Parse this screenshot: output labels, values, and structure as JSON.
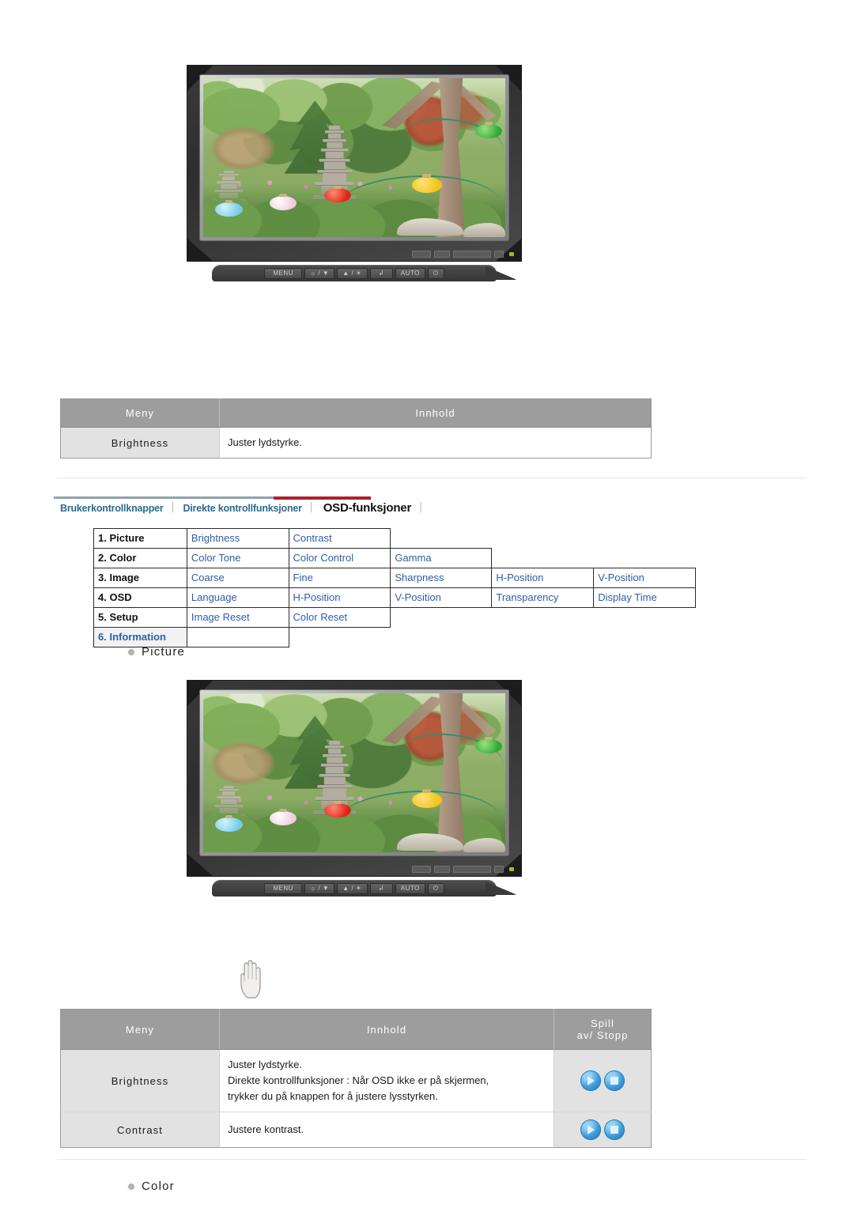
{
  "monitor": {
    "alt_top": "LCD monitor displaying a garden scene with pagoda and colorful lanterns",
    "alt_second": "LCD monitor displaying the same garden scene, with a hand cursor pointing at the MENU button",
    "controls": [
      {
        "name": "menu-button",
        "label": "MENU"
      },
      {
        "name": "brightness-down-button",
        "label": "☼ / ▼"
      },
      {
        "name": "brightness-up-button",
        "label": "▲ / ☀"
      },
      {
        "name": "enter-button",
        "label": "↲"
      },
      {
        "name": "auto-button",
        "label": "AUTO"
      },
      {
        "name": "power-button",
        "label": "⏻"
      }
    ]
  },
  "table_brightness": {
    "headers": [
      "Meny",
      "Innhold"
    ],
    "rows": [
      {
        "menu": "Brightness",
        "content": "Juster lydstyrke."
      }
    ]
  },
  "tabs": {
    "items": [
      {
        "label": "Brukerkontrollknapper",
        "active": false
      },
      {
        "label": "Direkte kontrollfunksjoner",
        "active": false
      },
      {
        "label": "OSD-funksjoner",
        "active": true
      }
    ],
    "separator": "│",
    "rule_color": "#8fa3ad",
    "active_rule_color": "#a62430",
    "link_color": "#2a6b91"
  },
  "osd_grid": {
    "rows": [
      {
        "label": "1. Picture",
        "options": [
          "Brightness",
          "Contrast"
        ]
      },
      {
        "label": "2. Color",
        "options": [
          "Color Tone",
          "Color Control",
          "Gamma"
        ]
      },
      {
        "label": "3. Image",
        "options": [
          "Coarse",
          "Fine",
          "Sharpness",
          "H-Position",
          "V-Position"
        ]
      },
      {
        "label": "4. OSD",
        "options": [
          "Language",
          "H-Position",
          "V-Position",
          "Transparency",
          "Display Time"
        ]
      },
      {
        "label": "5. Setup",
        "options": [
          "Image Reset",
          "Color Reset"
        ]
      },
      {
        "label": "6. Information",
        "options": [],
        "highlight": true
      }
    ],
    "option_color": "#2b5fa8"
  },
  "labels": {
    "picture": "Picture",
    "color": "Color"
  },
  "table_osd_controls": {
    "headers": [
      "Meny",
      "Innhold",
      "Spill\nav/ Stopp"
    ],
    "header_play_line1": "Spill",
    "header_play_line2": "av/ Stopp",
    "rows": [
      {
        "menu": "Brightness",
        "content_lines": [
          "Juster lydstyrke.",
          "Direkte kontrollfunksjoner : Når OSD ikke er på skjermen,",
          "trykker du på knappen for å justere lysstyrken."
        ],
        "play_label": "play-icon",
        "stop_label": "stop-icon"
      },
      {
        "menu": "Contrast",
        "content_lines": [
          "Justere kontrast."
        ],
        "play_label": "play-icon",
        "stop_label": "stop-icon"
      }
    ]
  },
  "colors": {
    "table_header_bg": "#9d9d9d",
    "table_menu_cell_bg": "#e2e2e2",
    "accent_red": "#a62430",
    "link_blue": "#2b5fa8",
    "divider": "#e6e6e6"
  }
}
